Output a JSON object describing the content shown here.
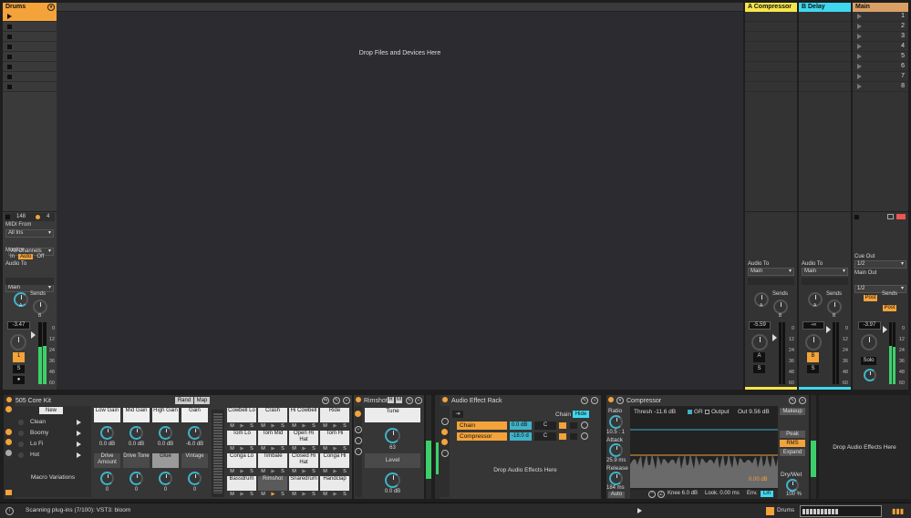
{
  "tracks": {
    "drums": {
      "name": "Drums",
      "tempo": "148",
      "beats": "4",
      "midi_from_label": "MIDI From",
      "midi_from": "All Ins",
      "midi_channel": "All Channels",
      "monitor_label": "Monitor",
      "monitor_opts": [
        "In",
        "Auto",
        "Off"
      ],
      "audio_to_label": "Audio To",
      "audio_to": "Main",
      "sends_label": "Sends",
      "send_a": "A",
      "send_b": "B",
      "volume": "-3.47",
      "track_num": "1",
      "solo": "S",
      "color": "#f3a33a"
    },
    "return_a": {
      "name": "A Compressor",
      "audio_to_label": "Audio To",
      "audio_to": "Main",
      "sends_label": "Sends",
      "send_a": "A",
      "send_b": "B",
      "volume": "-5.59",
      "letter": "A",
      "solo": "S",
      "color": "#f7e64a"
    },
    "return_b": {
      "name": "B Delay",
      "audio_to_label": "Audio To",
      "audio_to": "Main",
      "sends_label": "Sends",
      "send_a": "A",
      "send_b": "B",
      "volume": "-∞",
      "letter": "B",
      "solo": "S",
      "color": "#3fd8ee"
    },
    "main": {
      "name": "Main",
      "scenes": [
        "1",
        "2",
        "3",
        "4",
        "5",
        "6",
        "7",
        "8"
      ],
      "cue_out_label": "Cue Out",
      "cue_out": "1/2",
      "main_out_label": "Main Out",
      "main_out": "1/2",
      "sends_label": "Sends",
      "post1": "Post",
      "post2": "Post",
      "volume": "-3.97",
      "solo": "Solo",
      "color": "#d99f65"
    }
  },
  "drop_text": "Drop Files and Devices Here",
  "meter_scale": [
    "0",
    "12",
    "24",
    "36",
    "48",
    "60"
  ],
  "kit": {
    "title": "505 Core Kit",
    "new": "New",
    "presets": [
      "Clean",
      "Boomy",
      "Lo Fi",
      "Hot"
    ],
    "macro_variations": "Macro Variations",
    "rand": "Rand",
    "map": "Map",
    "macros": [
      {
        "name": "Low Gain",
        "value": "0.0 dB"
      },
      {
        "name": "Mid Gain",
        "value": "0.0 dB"
      },
      {
        "name": "High Gain",
        "value": "0.0 dB"
      },
      {
        "name": "Gain",
        "value": "-6.0 dB"
      },
      {
        "name": "Drive Amount",
        "value": "0"
      },
      {
        "name": "Drive Tone",
        "value": "0"
      },
      {
        "name": "Glue",
        "value": "0"
      },
      {
        "name": "Vintage",
        "value": "0"
      }
    ],
    "pads": [
      "Cowbell Lo",
      "Crash",
      "Hi Cowbell",
      "Ride",
      "Tom Lo",
      "Tom Mid",
      "Open Hi Hat",
      "Tom Hi",
      "Conga Lo",
      "Timbale",
      "Closed Hi Hat",
      "Conga Hi",
      "Bassdrum",
      "Rimshot",
      "Snaredrum",
      "Handclap"
    ],
    "pad_m": "M",
    "pad_s": "S"
  },
  "rimshot": {
    "title": "Rimshot",
    "r": "R",
    "m": "M",
    "tune_label": "Tune",
    "tune": "63",
    "level_label": "Level",
    "level": "0.0 dB"
  },
  "rack": {
    "title": "Audio Effect Rack",
    "chain_label": "Chain",
    "hide": "Hide",
    "chains": [
      {
        "name": "Chain",
        "vol": "0.0 dB",
        "pan": "C"
      },
      {
        "name": "Compressor",
        "vol": "-18.0 d",
        "pan": "C"
      }
    ],
    "drop": "Drop Audio Effects Here"
  },
  "compressor": {
    "title": "Compressor",
    "ratio_label": "Ratio",
    "ratio": "10.5 : 1",
    "attack_label": "Attack",
    "attack": "25.9 ms",
    "release_label": "Release",
    "release": "184 ms",
    "auto": "Auto",
    "thresh": "Thresh -11.6 dB",
    "gr": "GR",
    "output": "Output",
    "out": "Out 9.56 dB",
    "gr_value": "0.00 dB",
    "knee": "Knee 6.0 dB",
    "look": "Look. 0.00 ms",
    "env": "Env.",
    "env_mode": "Lin",
    "makeup": "Makeup",
    "peak": "Peak",
    "rms": "RMS",
    "expand": "Expand",
    "drywet_label": "Dry/Wet",
    "drywet": "100 %"
  },
  "drop_fx": "Drop Audio Effects Here",
  "status": {
    "text": "Scanning plug-ins (7/100): VST3: bloom",
    "track": "Drums"
  }
}
